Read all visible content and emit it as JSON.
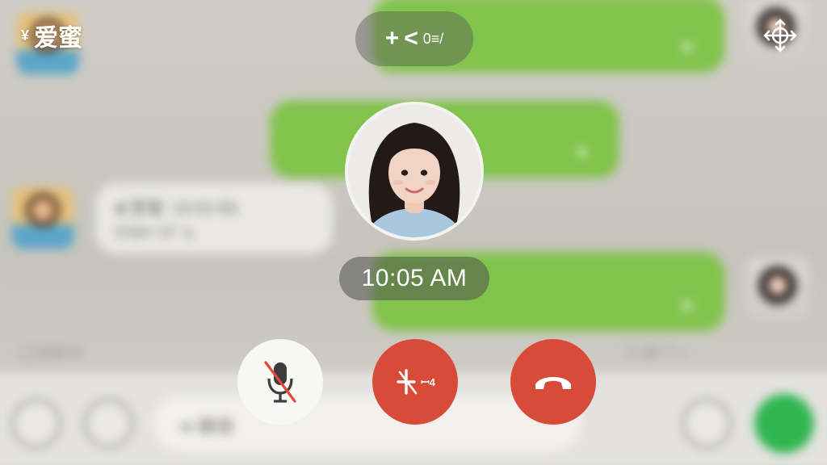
{
  "header": {
    "contact_prefix": "¥",
    "contact_name": "爱蜜"
  },
  "top_pill": {
    "plus": "+",
    "arrow": "<",
    "text": "0≡/"
  },
  "call": {
    "time": "10:05 AM"
  },
  "controls": {
    "speaker_text": "ꟷ4"
  },
  "background_chat": {
    "message_left_line1": "◂𝄃 爱蜜: 10:02 ᗺ1",
    "message_left_line2": "11Qm 12° ɋ",
    "meta_left": "◯1008 ♥",
    "meta_right": "☐ ⊕ᵃ 7 ◖",
    "input_text": "静音"
  },
  "colors": {
    "accent_green": "#82c34c",
    "hangup_red": "#d94b39",
    "send_green": "#2fb650"
  }
}
